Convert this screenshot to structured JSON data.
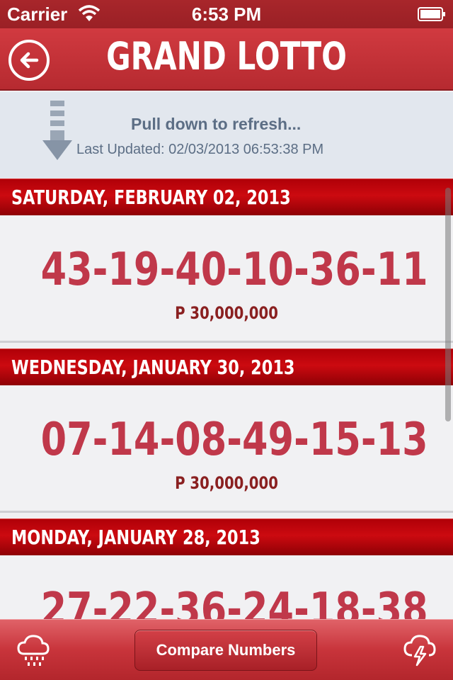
{
  "status_bar": {
    "carrier": "Carrier",
    "time": "6:53 PM"
  },
  "nav": {
    "title": "GRAND LOTTO",
    "back_icon": "back-arrow-icon"
  },
  "refresh": {
    "title": "Pull down to refresh...",
    "last_updated": "Last Updated: 02/03/2013 06:53:38 PM"
  },
  "draws": [
    {
      "date": "SATURDAY, FEBRUARY 02, 2013",
      "numbers": "43-19-40-10-36-11",
      "prize": "P 30,000,000"
    },
    {
      "date": "WEDNESDAY, JANUARY 30, 2013",
      "numbers": "07-14-08-49-15-13",
      "prize": "P 30,000,000"
    },
    {
      "date": "MONDAY, JANUARY 28, 2013",
      "numbers": "27-22-36-24-18-38",
      "prize": ""
    }
  ],
  "tab_bar": {
    "compare_label": "Compare Numbers",
    "left_icon": "rain-cloud-icon",
    "right_icon": "storm-cloud-icon"
  },
  "colors": {
    "nav_red": "#c0323a",
    "header_red": "#c0060c",
    "number_red": "#c0384a",
    "refresh_text": "#5c6e85"
  }
}
